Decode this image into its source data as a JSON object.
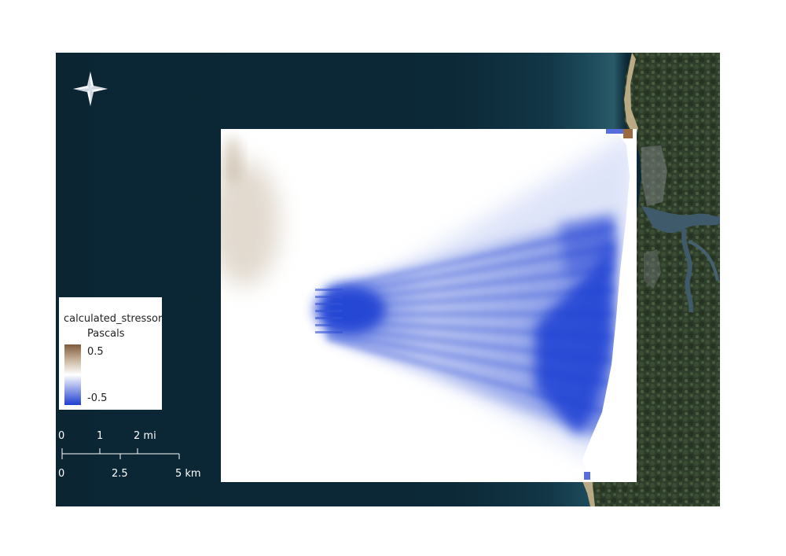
{
  "map": {
    "legend": {
      "title": "calculated_stressor",
      "units": "Pascals",
      "max_label": "0.5",
      "min_label": "-0.5",
      "color_max": "#7e5a3c",
      "color_mid": "#ffffff",
      "color_min": "#1f3fd3"
    },
    "scale_bar": {
      "miles_labels": [
        "0",
        "1",
        "2 mi"
      ],
      "km_labels": [
        "0",
        "2.5",
        "5 km"
      ]
    },
    "north_arrow_icon": "compass-rose-icon",
    "basemap_colors": {
      "ocean": "#0c2836",
      "land": "#2e3d2c"
    }
  }
}
